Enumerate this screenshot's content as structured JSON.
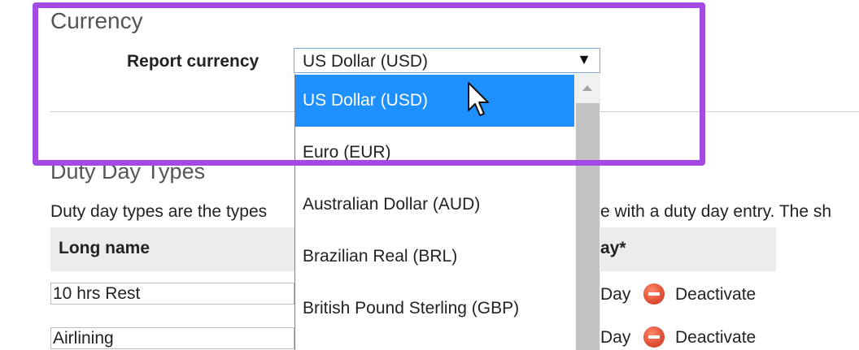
{
  "currency_section": {
    "title": "Currency",
    "report_currency_label": "Report currency",
    "selected_value": "US Dollar (USD)",
    "options": [
      "US Dollar (USD)",
      "Euro (EUR)",
      "Australian Dollar (AUD)",
      "Brazilian Real (BRL)",
      "British Pound Sterling (GBP)"
    ],
    "dropdown_arrow": "▼"
  },
  "duty_day_section": {
    "title": "Duty Day Types",
    "description_start": "Duty day types are the types",
    "description_end": "e with a duty day entry. The sh",
    "table": {
      "columns": [
        "Long name",
        "ay*"
      ],
      "rows": [
        {
          "long_name": "10 hrs Rest",
          "type": "Day",
          "action": "Deactivate"
        },
        {
          "long_name": "Airlining",
          "type": "Day",
          "action": "Deactivate"
        }
      ]
    }
  },
  "colors": {
    "highlight": "#a349e4",
    "selected_option": "#1e90ff",
    "deactivate_icon": "#e2543a"
  },
  "icons": {
    "cursor": "mouse-pointer-icon",
    "deactivate": "minus-circle-icon",
    "scroll_up": "scroll-up-arrow-icon"
  }
}
